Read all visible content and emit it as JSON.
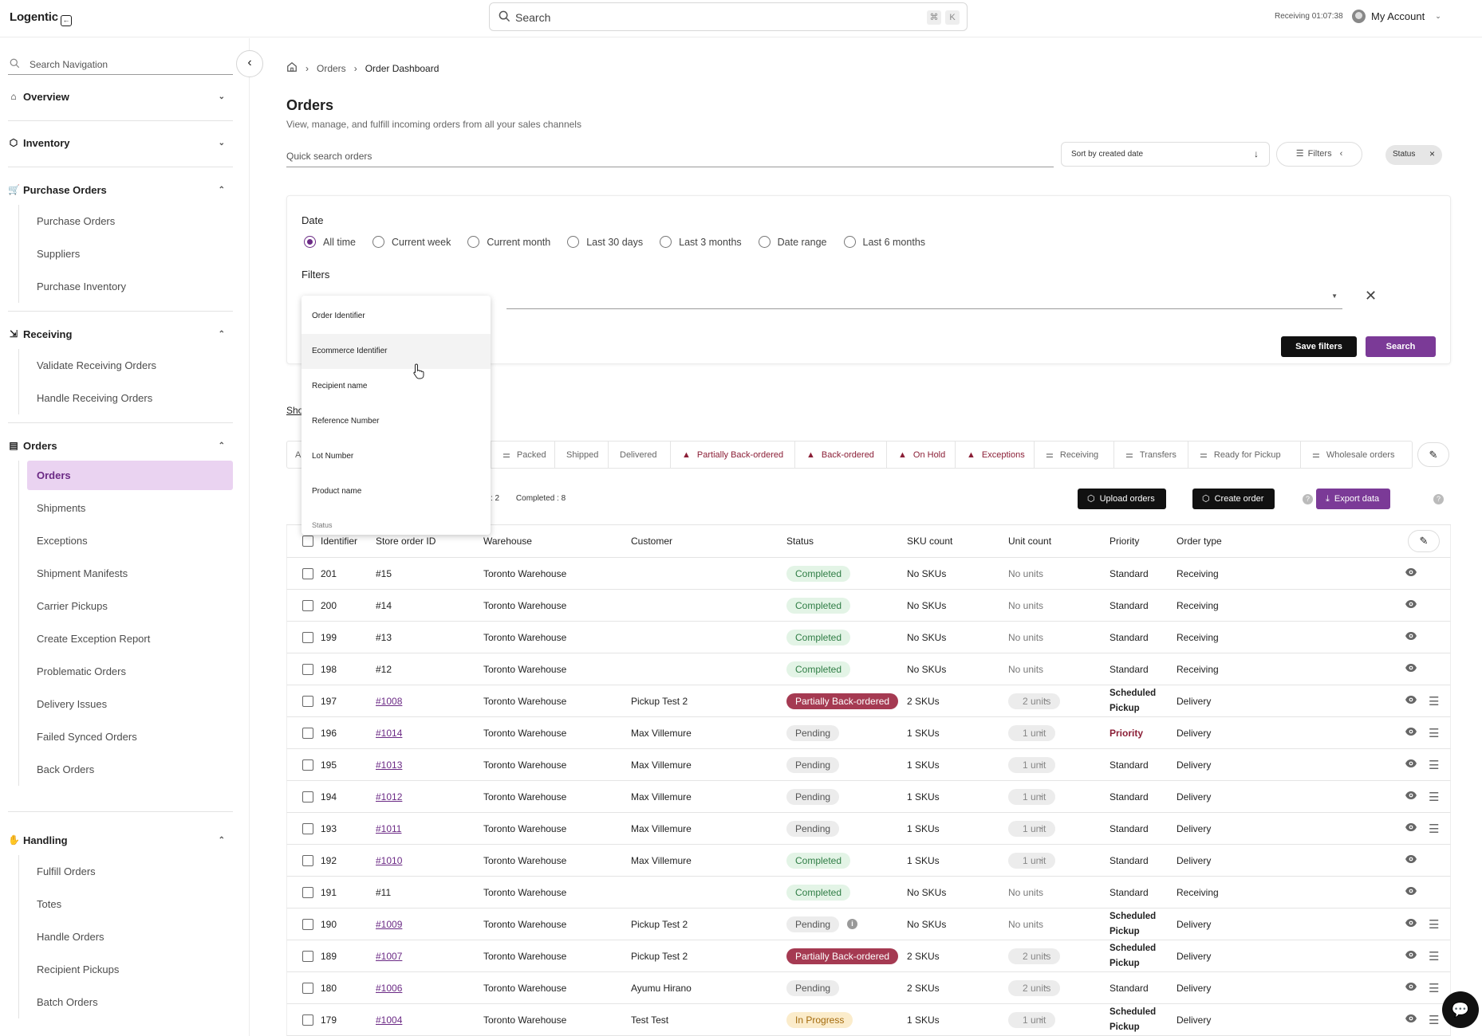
{
  "app": {
    "logo": "Logentic",
    "search_placeholder": "Search",
    "kbd1": "⌘",
    "kbd2": "K",
    "receiving_label": "Receiving",
    "receiving_time": "01:07:38",
    "account": "My Account"
  },
  "sidebar": {
    "search_placeholder": "Search Navigation",
    "sections": [
      {
        "label": "Overview",
        "icon": "home-icon",
        "items": []
      },
      {
        "label": "Inventory",
        "icon": "box-icon",
        "items": []
      },
      {
        "label": "Purchase Orders",
        "icon": "cart-icon",
        "items": [
          "Purchase Orders",
          "Suppliers",
          "Purchase Inventory"
        ]
      },
      {
        "label": "Receiving",
        "icon": "receive-icon",
        "items": [
          "Validate Receiving Orders",
          "Handle Receiving Orders"
        ]
      },
      {
        "label": "Orders",
        "icon": "document-icon",
        "items": [
          "Orders",
          "Shipments",
          "Exceptions",
          "Shipment Manifests",
          "Carrier Pickups",
          "Create Exception Report",
          "Problematic Orders",
          "Delivery Issues",
          "Failed Synced Orders",
          "Back Orders"
        ]
      },
      {
        "label": "Handling",
        "icon": "hand-icon",
        "items": [
          "Fulfill Orders",
          "Totes",
          "Handle Orders",
          "Recipient Pickups",
          "Batch Orders"
        ]
      }
    ]
  },
  "breadcrumb": {
    "orders": "Orders",
    "current": "Order Dashboard"
  },
  "page": {
    "title": "Orders",
    "subtitle": "View, manage, and fulfill incoming orders from all your sales channels",
    "quick_search_placeholder": "Quick search orders",
    "sort_label": "Sort by created date",
    "filters_label": "Filters",
    "status_chip": "Status"
  },
  "filter_panel": {
    "date_label": "Date",
    "date_options": [
      "All time",
      "Current week",
      "Current month",
      "Last 30 days",
      "Last 3 months",
      "Date range",
      "Last 6 months"
    ],
    "selected_date": "All time",
    "filters_label": "Filters",
    "save_filters": "Save filters",
    "search": "Search"
  },
  "field_dropdown": {
    "options": [
      "Order Identifier",
      "Ecommerce Identifier",
      "Recipient name",
      "Reference Number",
      "Lot Number",
      "Product name",
      "Status"
    ],
    "hovered": "Ecommerce Identifier"
  },
  "show_link": "Sho",
  "tabs": [
    {
      "label": "A",
      "icon": "",
      "warn": false
    },
    {
      "label": "Packed",
      "icon": "sliders-icon",
      "warn": false
    },
    {
      "label": "Shipped",
      "icon": "",
      "warn": false
    },
    {
      "label": "Delivered",
      "icon": "",
      "warn": false
    },
    {
      "label": "Partially Back-ordered",
      "icon": "warning-icon",
      "warn": true
    },
    {
      "label": "Back-ordered",
      "icon": "warning-icon",
      "warn": true
    },
    {
      "label": "On Hold",
      "icon": "warning-icon",
      "warn": true
    },
    {
      "label": "Exceptions",
      "icon": "warning-icon",
      "warn": true
    },
    {
      "label": "Receiving",
      "icon": "sliders-icon",
      "warn": false
    },
    {
      "label": "Transfers",
      "icon": "sliders-icon",
      "warn": false
    },
    {
      "label": "Ready for Pickup",
      "icon": "sliders-icon",
      "warn": false
    },
    {
      "label": "Wholesale orders",
      "icon": "sliders-icon",
      "warn": false
    }
  ],
  "summary": {
    "partial": ": 2",
    "completed": "Completed : 8"
  },
  "toolbar": {
    "upload": "Upload orders",
    "create": "Create order",
    "export": "Export data"
  },
  "table": {
    "columns": [
      "Identifier",
      "Store order ID",
      "Warehouse",
      "Customer",
      "Status",
      "SKU count",
      "Unit count",
      "Priority",
      "Order type"
    ],
    "rows": [
      {
        "id": "201",
        "store": "#15",
        "link": false,
        "warehouse": "Toronto Warehouse",
        "customer": "",
        "status": "Completed",
        "sku": "No SKUs",
        "units": "No units",
        "unit_pill": false,
        "priority": "Standard",
        "type": "Receiving",
        "menu": false,
        "info": false
      },
      {
        "id": "200",
        "store": "#14",
        "link": false,
        "warehouse": "Toronto Warehouse",
        "customer": "",
        "status": "Completed",
        "sku": "No SKUs",
        "units": "No units",
        "unit_pill": false,
        "priority": "Standard",
        "type": "Receiving",
        "menu": false,
        "info": false
      },
      {
        "id": "199",
        "store": "#13",
        "link": false,
        "warehouse": "Toronto Warehouse",
        "customer": "",
        "status": "Completed",
        "sku": "No SKUs",
        "units": "No units",
        "unit_pill": false,
        "priority": "Standard",
        "type": "Receiving",
        "menu": false,
        "info": false
      },
      {
        "id": "198",
        "store": "#12",
        "link": false,
        "warehouse": "Toronto Warehouse",
        "customer": "",
        "status": "Completed",
        "sku": "No SKUs",
        "units": "No units",
        "unit_pill": false,
        "priority": "Standard",
        "type": "Receiving",
        "menu": false,
        "info": false
      },
      {
        "id": "197",
        "store": "#1008",
        "link": true,
        "warehouse": "Toronto Warehouse",
        "customer": "Pickup Test 2",
        "status": "Partially Back-ordered",
        "sku": "2 SKUs",
        "units": "2 units",
        "unit_pill": true,
        "priority": "Scheduled Pickup",
        "type": "Delivery",
        "menu": true,
        "info": false
      },
      {
        "id": "196",
        "store": "#1014",
        "link": true,
        "warehouse": "Toronto Warehouse",
        "customer": "Max Villemure",
        "status": "Pending",
        "sku": "1 SKUs",
        "units": "1 unit",
        "unit_pill": true,
        "priority": "Priority",
        "type": "Delivery",
        "menu": true,
        "info": false
      },
      {
        "id": "195",
        "store": "#1013",
        "link": true,
        "warehouse": "Toronto Warehouse",
        "customer": "Max Villemure",
        "status": "Pending",
        "sku": "1 SKUs",
        "units": "1 unit",
        "unit_pill": true,
        "priority": "Standard",
        "type": "Delivery",
        "menu": true,
        "info": false
      },
      {
        "id": "194",
        "store": "#1012",
        "link": true,
        "warehouse": "Toronto Warehouse",
        "customer": "Max Villemure",
        "status": "Pending",
        "sku": "1 SKUs",
        "units": "1 unit",
        "unit_pill": true,
        "priority": "Standard",
        "type": "Delivery",
        "menu": true,
        "info": false
      },
      {
        "id": "193",
        "store": "#1011",
        "link": true,
        "warehouse": "Toronto Warehouse",
        "customer": "Max Villemure",
        "status": "Pending",
        "sku": "1 SKUs",
        "units": "1 unit",
        "unit_pill": true,
        "priority": "Standard",
        "type": "Delivery",
        "menu": true,
        "info": false
      },
      {
        "id": "192",
        "store": "#1010",
        "link": true,
        "warehouse": "Toronto Warehouse",
        "customer": "Max Villemure",
        "status": "Completed",
        "sku": "1 SKUs",
        "units": "1 unit",
        "unit_pill": true,
        "priority": "Standard",
        "type": "Delivery",
        "menu": false,
        "info": false
      },
      {
        "id": "191",
        "store": "#11",
        "link": false,
        "warehouse": "Toronto Warehouse",
        "customer": "",
        "status": "Completed",
        "sku": "No SKUs",
        "units": "No units",
        "unit_pill": false,
        "priority": "Standard",
        "type": "Receiving",
        "menu": false,
        "info": false
      },
      {
        "id": "190",
        "store": "#1009",
        "link": true,
        "warehouse": "Toronto Warehouse",
        "customer": "Pickup Test 2",
        "status": "Pending",
        "sku": "No SKUs",
        "units": "No units",
        "unit_pill": false,
        "priority": "Scheduled Pickup",
        "type": "Delivery",
        "menu": true,
        "info": true
      },
      {
        "id": "189",
        "store": "#1007",
        "link": true,
        "warehouse": "Toronto Warehouse",
        "customer": "Pickup Test 2",
        "status": "Partially Back-ordered",
        "sku": "2 SKUs",
        "units": "2 units",
        "unit_pill": true,
        "priority": "Scheduled Pickup",
        "type": "Delivery",
        "menu": true,
        "info": false
      },
      {
        "id": "180",
        "store": "#1006",
        "link": true,
        "warehouse": "Toronto Warehouse",
        "customer": "Ayumu Hirano",
        "status": "Pending",
        "sku": "2 SKUs",
        "units": "2 units",
        "unit_pill": true,
        "priority": "Standard",
        "type": "Delivery",
        "menu": true,
        "info": false
      },
      {
        "id": "179",
        "store": "#1004",
        "link": true,
        "warehouse": "Toronto Warehouse",
        "customer": "Test Test",
        "status": "In Progress",
        "sku": "1 SKUs",
        "units": "1 unit",
        "unit_pill": true,
        "priority": "Scheduled Pickup",
        "type": "Delivery",
        "menu": true,
        "info": false
      }
    ]
  },
  "colors": {
    "accent": "#7b3a97",
    "warn": "#8b1f37",
    "active_nav_bg": "#ead3f1"
  }
}
